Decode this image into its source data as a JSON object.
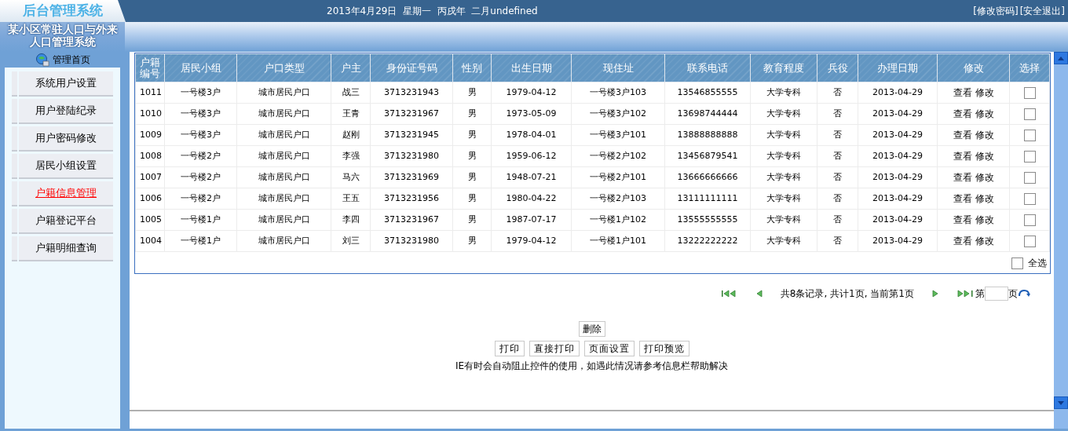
{
  "header": {
    "logo": "后台管理系统",
    "date": "2013年4月29日  星期一  丙戌年  二月undefined",
    "links": [
      "[修改密码]",
      "[安全退出]"
    ]
  },
  "sidebar": {
    "title": "某小区常驻人口与外来人口管理系统",
    "home": "管理首页",
    "items": [
      {
        "label": "系统用户设置",
        "selected": false
      },
      {
        "label": "用户登陆纪录",
        "selected": false
      },
      {
        "label": "用户密码修改",
        "selected": false
      },
      {
        "label": "居民小组设置",
        "selected": false
      },
      {
        "label": "户籍信息管理",
        "selected": true
      },
      {
        "label": "户籍登记平台",
        "selected": false
      },
      {
        "label": "户籍明细查询",
        "selected": false
      }
    ]
  },
  "table": {
    "columns": [
      "户籍编号",
      "居民小组",
      "户口类型",
      "户主",
      "身份证号码",
      "性别",
      "出生日期",
      "现住址",
      "联系电话",
      "教育程度",
      "兵役",
      "办理日期",
      "修改",
      "选择"
    ],
    "rows": [
      {
        "cells": [
          "1011",
          "一号楼3户",
          "城市居民户口",
          "战三",
          "3713231943",
          "男",
          "1979-04-12",
          "一号楼3户103",
          "13546855555",
          "大学专科",
          "否",
          "2013-04-29"
        ],
        "actions": [
          "查看",
          "修改"
        ],
        "checked": false
      },
      {
        "cells": [
          "1010",
          "一号楼3户",
          "城市居民户口",
          "王青",
          "3713231967",
          "男",
          "1973-05-09",
          "一号楼3户102",
          "13698744444",
          "大学专科",
          "否",
          "2013-04-29"
        ],
        "actions": [
          "查看",
          "修改"
        ],
        "checked": false
      },
      {
        "cells": [
          "1009",
          "一号楼3户",
          "城市居民户口",
          "赵刚",
          "3713231945",
          "男",
          "1978-04-01",
          "一号楼3户101",
          "13888888888",
          "大学专科",
          "否",
          "2013-04-29"
        ],
        "actions": [
          "查看",
          "修改"
        ],
        "checked": false
      },
      {
        "cells": [
          "1008",
          "一号楼2户",
          "城市居民户口",
          "李强",
          "3713231980",
          "男",
          "1959-06-12",
          "一号楼2户102",
          "13456879541",
          "大学专科",
          "否",
          "2013-04-29"
        ],
        "actions": [
          "查看",
          "修改"
        ],
        "checked": false
      },
      {
        "cells": [
          "1007",
          "一号楼2户",
          "城市居民户口",
          "马六",
          "3713231969",
          "男",
          "1948-07-21",
          "一号楼2户101",
          "13666666666",
          "大学专科",
          "否",
          "2013-04-29"
        ],
        "actions": [
          "查看",
          "修改"
        ],
        "checked": false
      },
      {
        "cells": [
          "1006",
          "一号楼2户",
          "城市居民户口",
          "王五",
          "3713231956",
          "男",
          "1980-04-22",
          "一号楼2户103",
          "13111111111",
          "大学专科",
          "否",
          "2013-04-29"
        ],
        "actions": [
          "查看",
          "修改"
        ],
        "checked": false
      },
      {
        "cells": [
          "1005",
          "一号楼1户",
          "城市居民户口",
          "李四",
          "3713231967",
          "男",
          "1987-07-17",
          "一号楼1户102",
          "13555555555",
          "大学专科",
          "否",
          "2013-04-29"
        ],
        "actions": [
          "查看",
          "修改"
        ],
        "checked": false
      },
      {
        "cells": [
          "1004",
          "一号楼1户",
          "城市居民户口",
          "刘三",
          "3713231980",
          "男",
          "1979-04-12",
          "一号楼1户101",
          "13222222222",
          "大学专科",
          "否",
          "2013-04-29"
        ],
        "actions": [
          "查看",
          "修改"
        ],
        "checked": false
      }
    ],
    "select_all": {
      "label": "全选",
      "checked": false
    }
  },
  "pagination": {
    "summary": "共8条记录, 共计1页, 当前第1页",
    "page_prefix": "第",
    "page_suffix": "页"
  },
  "delete_button": "删除",
  "print_buttons": [
    "打印",
    "直接打印",
    "页面设置",
    "打印预览"
  ],
  "note": "IE有时会自动阻止控件的使用，如遇此情况请参考信息栏帮助解决"
}
